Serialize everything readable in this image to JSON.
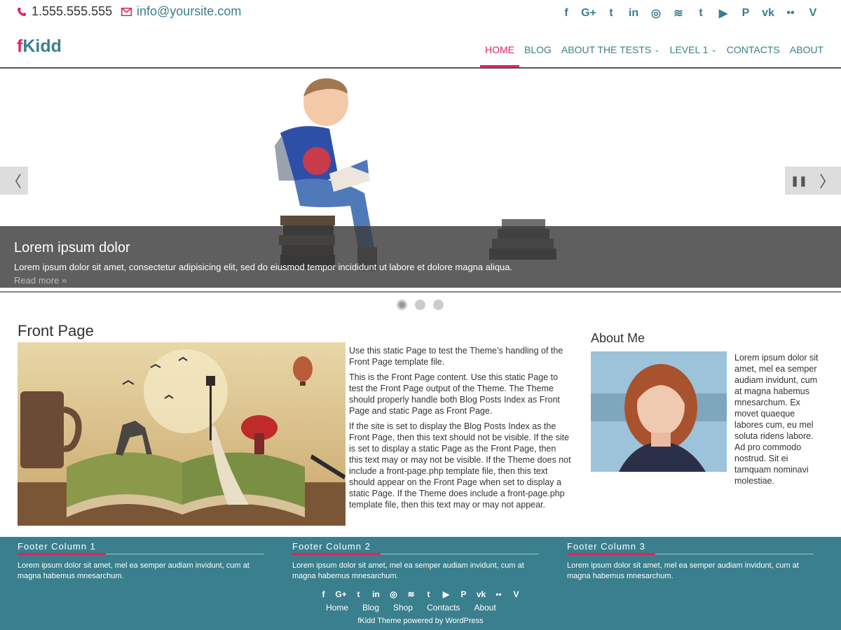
{
  "topbar": {
    "phone": "1.555.555.555",
    "email": "info@yoursite.com",
    "phone_icon": "phone-icon",
    "email_icon": "envelope-icon"
  },
  "social": [
    {
      "name": "facebook-icon",
      "glyph": "f"
    },
    {
      "name": "google-plus-icon",
      "glyph": "G+"
    },
    {
      "name": "twitter-icon",
      "glyph": "t"
    },
    {
      "name": "linkedin-icon",
      "glyph": "in"
    },
    {
      "name": "instagram-icon",
      "glyph": "◎"
    },
    {
      "name": "rss-icon",
      "glyph": "≋"
    },
    {
      "name": "tumblr-icon",
      "glyph": "t"
    },
    {
      "name": "youtube-icon",
      "glyph": "▶"
    },
    {
      "name": "pinterest-icon",
      "glyph": "P"
    },
    {
      "name": "vk-icon",
      "glyph": "vk"
    },
    {
      "name": "flickr-icon",
      "glyph": "••"
    },
    {
      "name": "vine-icon",
      "glyph": "V"
    }
  ],
  "header": {
    "logo_part1": "f",
    "logo_part2": "Kidd",
    "nav": [
      {
        "label": "HOME",
        "active": true,
        "caret": ""
      },
      {
        "label": "BLOG",
        "active": false,
        "caret": ""
      },
      {
        "label": "ABOUT THE TESTS",
        "active": false,
        "caret": "⌄"
      },
      {
        "label": "LEVEL 1",
        "active": false,
        "caret": "⌄"
      },
      {
        "label": "CONTACTS",
        "active": false,
        "caret": ""
      },
      {
        "label": "ABOUT",
        "active": false,
        "caret": ""
      }
    ]
  },
  "slider": {
    "title": "Lorem ipsum dolor",
    "text": "Lorem ipsum dolor sit amet, consectetur adipisicing elit, sed do eiusmod tempor incididunt ut labore et dolore magna aliqua.",
    "more": "Read more »",
    "prev_glyph": "〈",
    "next_glyph": "〉",
    "pause_glyph": "❚❚",
    "dots": 3,
    "active_dot": 0
  },
  "main": {
    "title": "Front Page",
    "paragraphs": [
      "Use this static Page to test the Theme’s handling of the Front Page template file.",
      "This is the Front Page content. Use this static Page to test the Front Page output of the Theme. The Theme should properly handle both Blog Posts Index as Front Page and static Page as Front Page.",
      "If the site is set to display the Blog Posts Index as the Front Page, then this text should not be visible. If the site is set to display a static Page as the Front Page, then this text may or may not be visible. If the Theme does not include a front-page.php template file, then this text should appear on the Front Page when set to display a static Page. If the Theme does include a front-page.php template file, then this text may or may not appear."
    ]
  },
  "aside": {
    "title": "About Me",
    "text": "Lorem ipsum dolor sit amet, mel ea semper audiam invidunt, cum at magna habemus mnesarchum. Ex movet quaeque labores cum, eu mel soluta ridens labore. Ad pro commodo nostrud. Sit ei tamquam nominavi molestiae."
  },
  "footer": {
    "columns": [
      {
        "title": "Footer Column 1",
        "text": "Lorem ipsum dolor sit amet, mel ea semper audiam invidunt, cum at magna habemus mnesarchum."
      },
      {
        "title": "Footer Column 2",
        "text": "Lorem ipsum dolor sit amet, mel ea semper audiam invidunt, cum at magna habemus mnesarchum."
      },
      {
        "title": "Footer Column 3",
        "text": "Lorem ipsum dolor sit amet, mel ea semper audiam invidunt, cum at magna habemus mnesarchum."
      }
    ],
    "links": [
      "Home",
      "Blog",
      "Shop",
      "Contacts",
      "About"
    ],
    "credit": "fKidd Theme powered by WordPress"
  },
  "colors": {
    "accent": "#e0245e",
    "teal": "#3a7f8d"
  }
}
